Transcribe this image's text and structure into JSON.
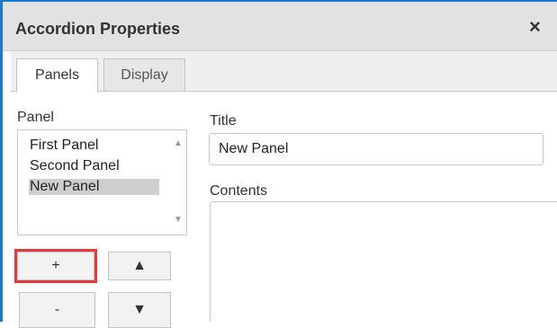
{
  "window": {
    "title": "Accordion Properties",
    "close_icon": "×"
  },
  "tabs": [
    {
      "label": "Panels",
      "active": true
    },
    {
      "label": "Display",
      "active": false
    }
  ],
  "panel_list": {
    "label": "Panel",
    "items": [
      "First Panel",
      "Second Panel",
      "New Panel"
    ],
    "selected": "New Panel"
  },
  "buttons": {
    "add": "+",
    "remove": "-",
    "move_up": "▲",
    "move_down": "▼"
  },
  "title_field": {
    "label": "Title",
    "value": "New Panel"
  },
  "contents_field": {
    "label": "Contents",
    "value": ""
  },
  "colors": {
    "frame": "#1e7ac8",
    "highlight": "#e23b3b",
    "selection": "#cfcfcf"
  }
}
